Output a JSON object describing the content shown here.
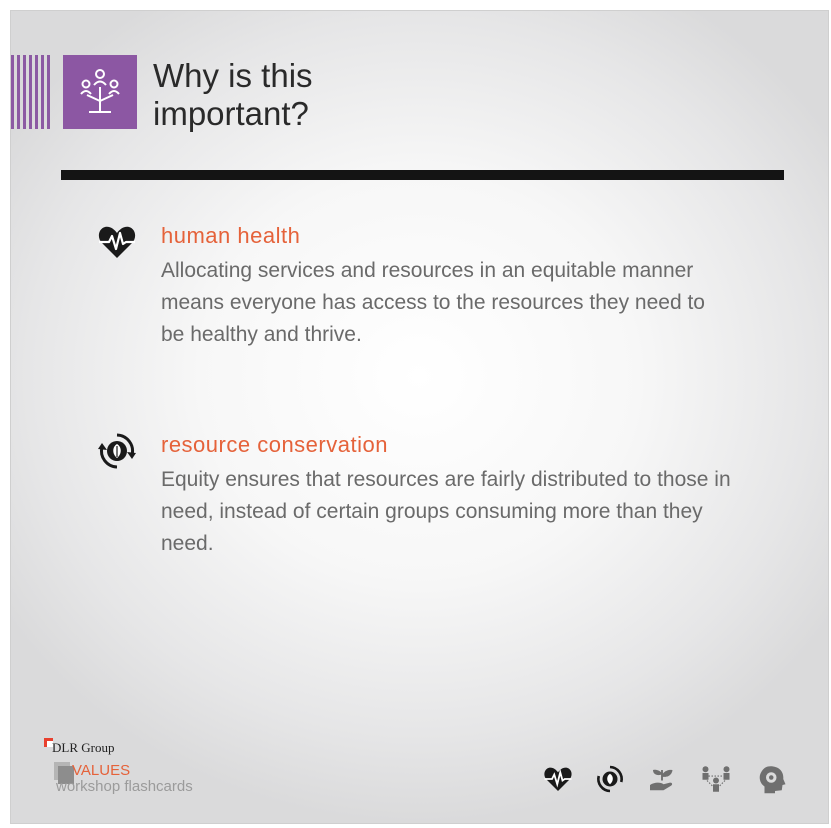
{
  "header": {
    "title_line1": "Why is this",
    "title_line2": "important?",
    "accent_color": "#8c57a3"
  },
  "sections": [
    {
      "icon": "heart-pulse-icon",
      "title": "human health",
      "body": "Allocating services and resources in an equitable manner means everyone has access to the resources they need to be healthy and thrive."
    },
    {
      "icon": "recycle-leaf-icon",
      "title": "resource conservation",
      "body": "Equity ensures that resources are fairly distributed to those in need, instead of certain groups consuming more than they need."
    }
  ],
  "footer": {
    "brand": "DLR Group",
    "values_label": "VALUES",
    "workshop_label": "workshop flashcards",
    "icons": [
      "heart-pulse-icon",
      "recycle-leaf-icon",
      "hand-sprout-icon",
      "community-icon",
      "head-gear-icon"
    ]
  },
  "colors": {
    "heading": "#e5623a",
    "body_text": "#6a6a6a",
    "rule": "#141414"
  }
}
